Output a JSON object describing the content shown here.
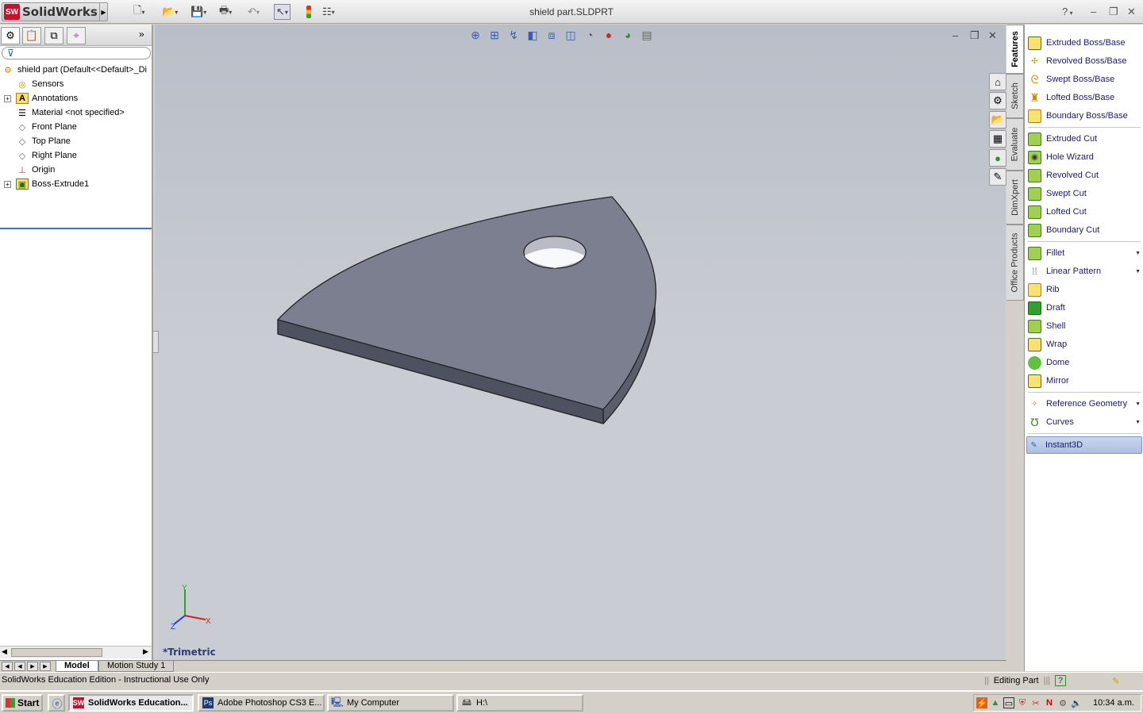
{
  "app": {
    "logo_text": "SolidWorks",
    "logo_badge": "SW",
    "document_title": "shield part.SLDPRT"
  },
  "tree": {
    "root": "shield part  (Default<<Default>_Di",
    "items": [
      {
        "label": "Sensors",
        "expandable": false,
        "icon": "sensor-icon"
      },
      {
        "label": "Annotations",
        "expandable": true,
        "icon": "annotations-icon"
      },
      {
        "label": "Material <not specified>",
        "expandable": false,
        "icon": "material-icon"
      },
      {
        "label": "Front Plane",
        "expandable": false,
        "icon": "plane-icon"
      },
      {
        "label": "Top Plane",
        "expandable": false,
        "icon": "plane-icon"
      },
      {
        "label": "Right Plane",
        "expandable": false,
        "icon": "plane-icon"
      },
      {
        "label": "Origin",
        "expandable": false,
        "icon": "origin-icon"
      },
      {
        "label": "Boss-Extrude1",
        "expandable": true,
        "icon": "extrude-icon"
      }
    ]
  },
  "viewport": {
    "view_label": "*Trimetric",
    "triad": {
      "y": "Y",
      "x": "X",
      "z": "Z"
    }
  },
  "taskpane_tabs": [
    "Features",
    "Sketch",
    "Evaluate",
    "DimXpert",
    "Office Products"
  ],
  "active_tab": "Features",
  "commands": {
    "group1": [
      "Extruded Boss/Base",
      "Revolved Boss/Base",
      "Swept Boss/Base",
      "Lofted Boss/Base",
      "Boundary Boss/Base"
    ],
    "group2": [
      "Extruded Cut",
      "Hole Wizard",
      "Revolved Cut",
      "Swept Cut",
      "Lofted Cut",
      "Boundary Cut"
    ],
    "group3": [
      "Fillet",
      "Linear Pattern",
      "Rib",
      "Draft",
      "Shell",
      "Wrap",
      "Dome",
      "Mirror"
    ],
    "group4": [
      "Reference Geometry",
      "Curves"
    ],
    "group5": [
      "Instant3D"
    ]
  },
  "bottom_tabs": [
    "Model",
    "Motion Study 1"
  ],
  "status": {
    "left": "SolidWorks Education Edition - Instructional Use Only",
    "right": "Editing Part"
  },
  "taskbar": {
    "start": "Start",
    "tasks": [
      "SolidWorks Education...",
      "Adobe Photoshop CS3 E...",
      "My Computer",
      "H:\\"
    ],
    "clock": "10:34 a.m."
  }
}
